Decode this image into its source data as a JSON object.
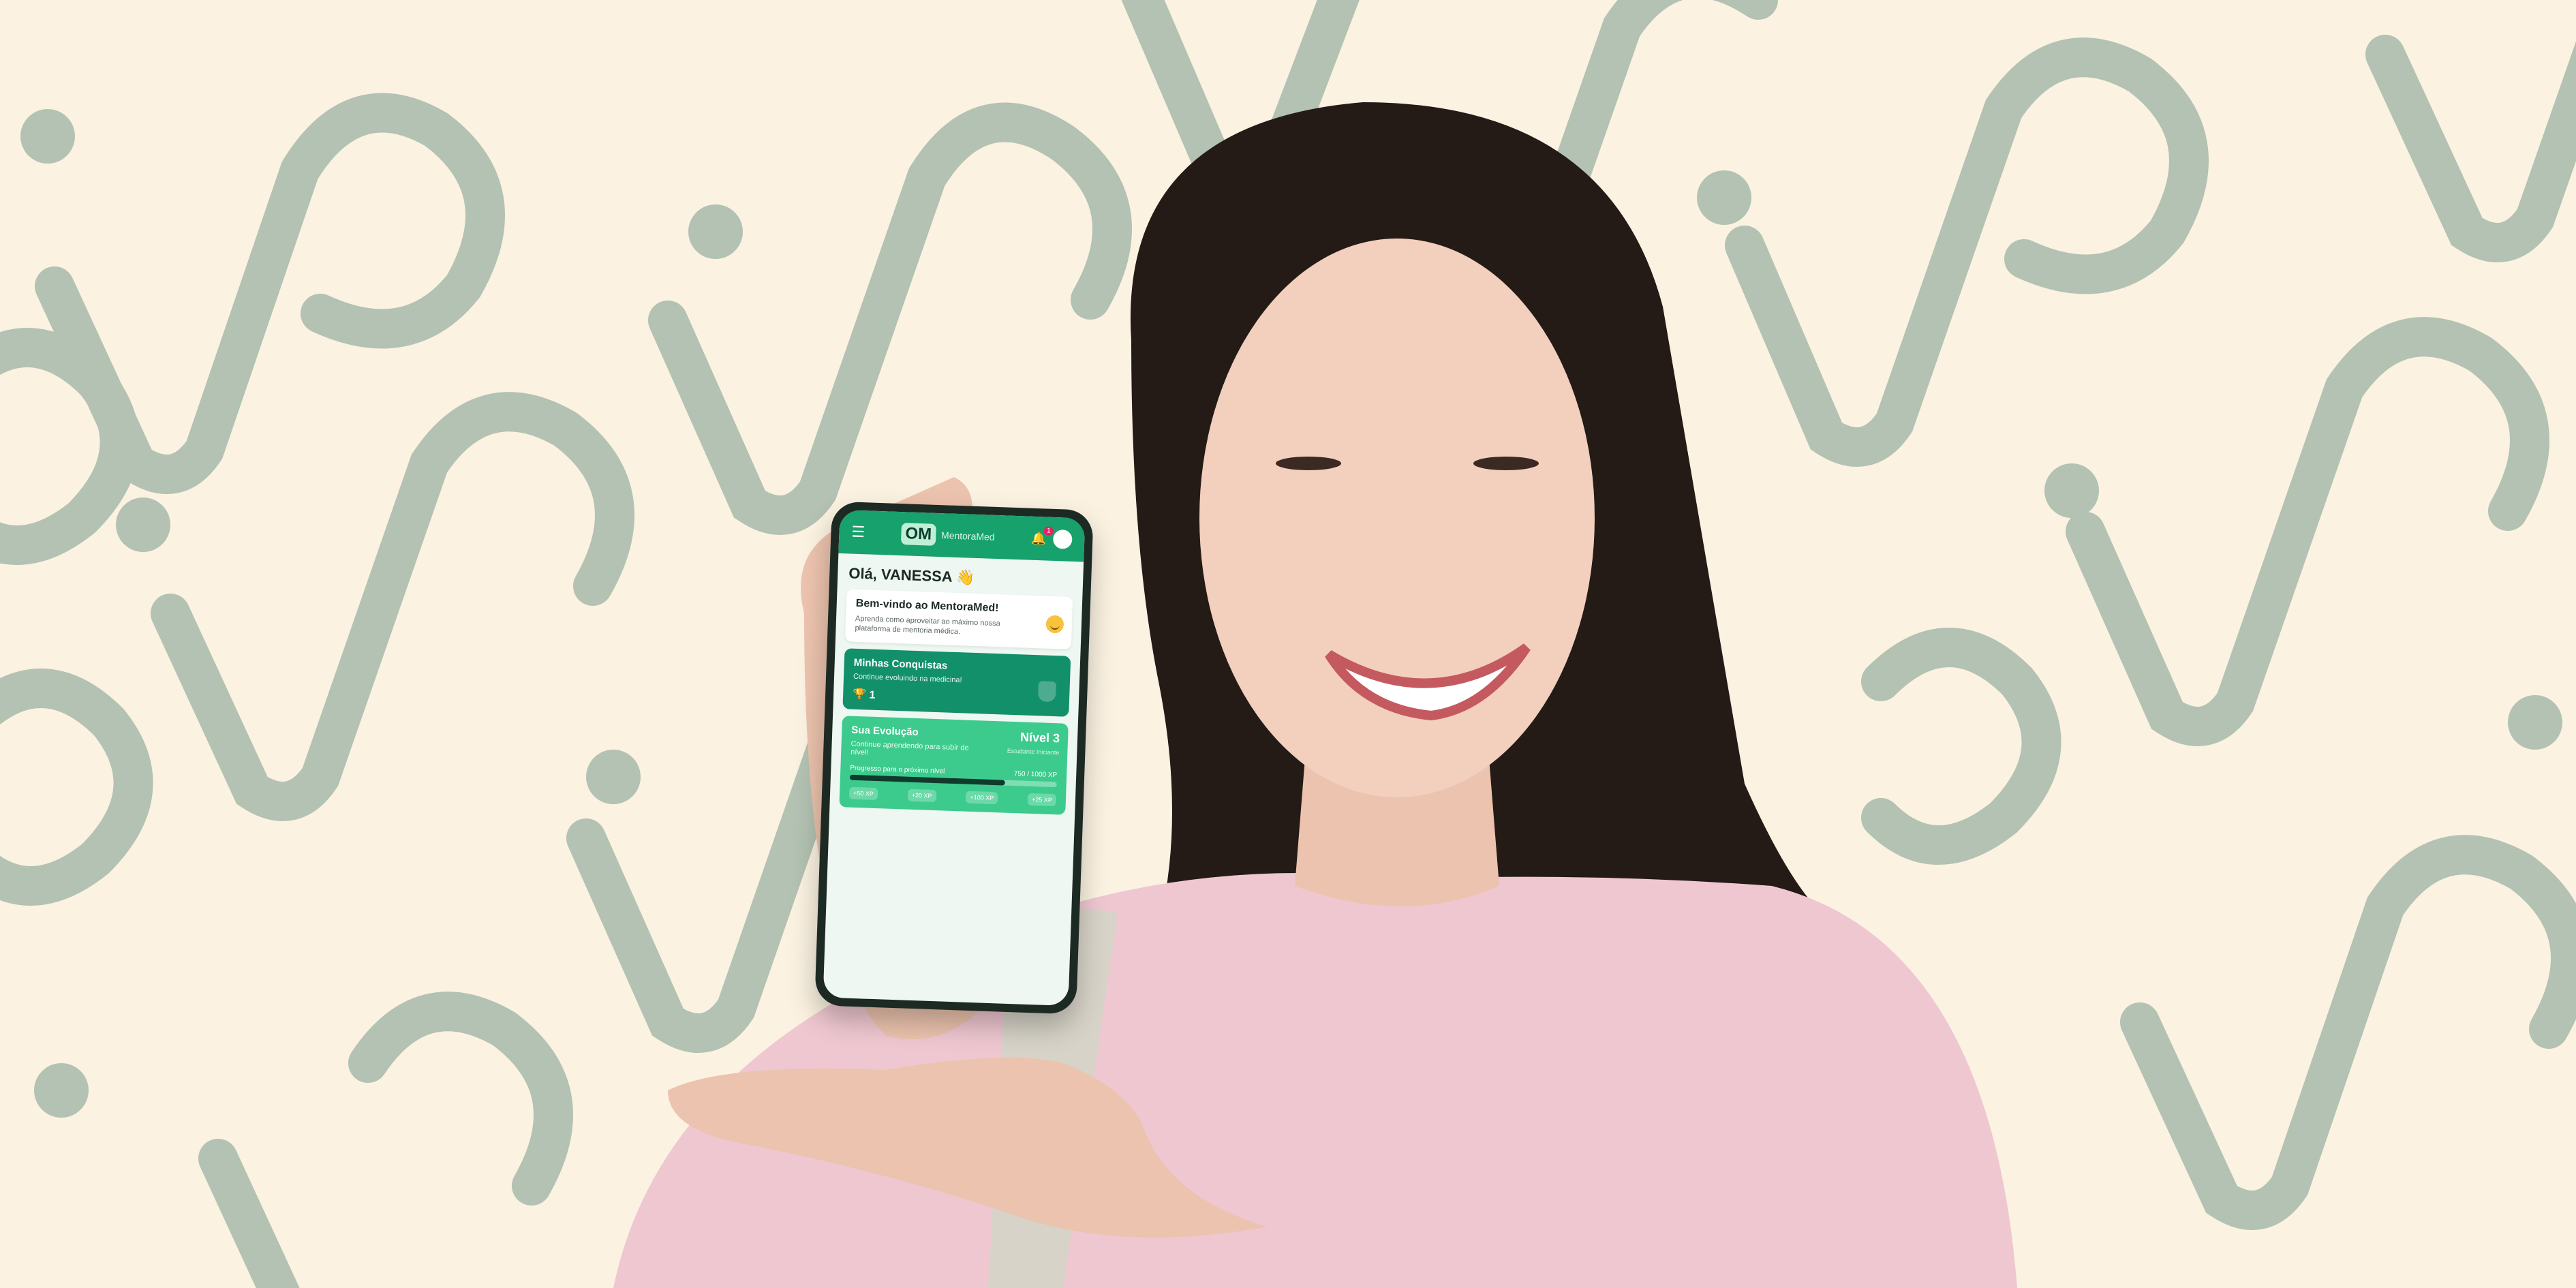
{
  "scene": {
    "background_color": "#fbf2e1",
    "pattern_color": "#b3c2b2",
    "sweater_color": "#efc7d1",
    "hair_color": "#241a16",
    "skin_color": "#f2d0bd"
  },
  "phone": {
    "app_logo_mark": "OM",
    "app_logo_text": "MentoraMed",
    "notification_count": "1",
    "greeting": "Olá, VANESSA 👋",
    "welcome_card": {
      "title": "Bem-vindo ao MentoraMed!",
      "text": "Aprenda como aproveitar ao máximo nossa plataforma de mentoria médica."
    },
    "achievements_card": {
      "title": "Minhas Conquistas",
      "subtitle": "Continue evoluindo na medicina!",
      "count": "🏆 1"
    },
    "evolution_card": {
      "title": "Sua Evolução",
      "subtitle": "Continue aprendendo para subir de nível!",
      "level": "Nível 3",
      "level_caption": "Estudante Iniciante",
      "progress_label": "Progresso para o próximo nível",
      "progress_value": "750 / 1000 XP",
      "progress_fraction": 0.75,
      "xp_items": [
        "+50 XP",
        "+20 XP",
        "+100 XP",
        "+25 XP"
      ]
    },
    "colors": {
      "appbar": "#17a16c",
      "card_dark": "#12906a",
      "card_light": "#3ccb8d"
    }
  }
}
